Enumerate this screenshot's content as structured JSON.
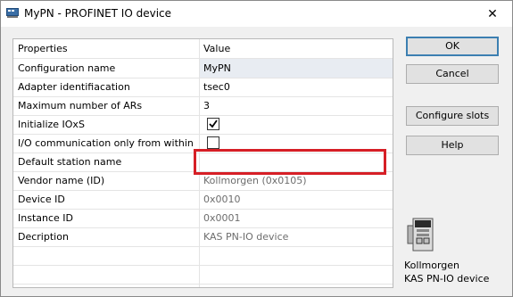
{
  "window": {
    "title": "MyPN - PROFINET IO device",
    "close_glyph": "✕"
  },
  "table": {
    "header": {
      "property": "Properties",
      "value": "Value"
    },
    "rows": [
      {
        "name": "Configuration name",
        "value": "MyPN"
      },
      {
        "name": "Adapter identifiacation",
        "value": "tsec0"
      },
      {
        "name": "Maximum number of ARs",
        "value": "3"
      },
      {
        "name": "Initialize IOxS",
        "value": "",
        "checked": true
      },
      {
        "name": "I/O communication only from within cycle",
        "value": "",
        "checked": false
      },
      {
        "name": "Default station name",
        "value": ""
      },
      {
        "name": "Vendor name (ID)",
        "value": "Kollmorgen (0x0105)"
      },
      {
        "name": "Device ID",
        "value": "0x0010"
      },
      {
        "name": "Instance ID",
        "value": "0x0001"
      },
      {
        "name": "Decription",
        "value": "KAS PN-IO device"
      }
    ]
  },
  "buttons": {
    "ok": "OK",
    "cancel": "Cancel",
    "configure_slots": "Configure slots",
    "help": "Help"
  },
  "device": {
    "vendor": "Kollmorgen",
    "model": "KAS PN-IO device"
  },
  "colors": {
    "highlight": "#d61f26",
    "selection": "#e8ecf2"
  }
}
